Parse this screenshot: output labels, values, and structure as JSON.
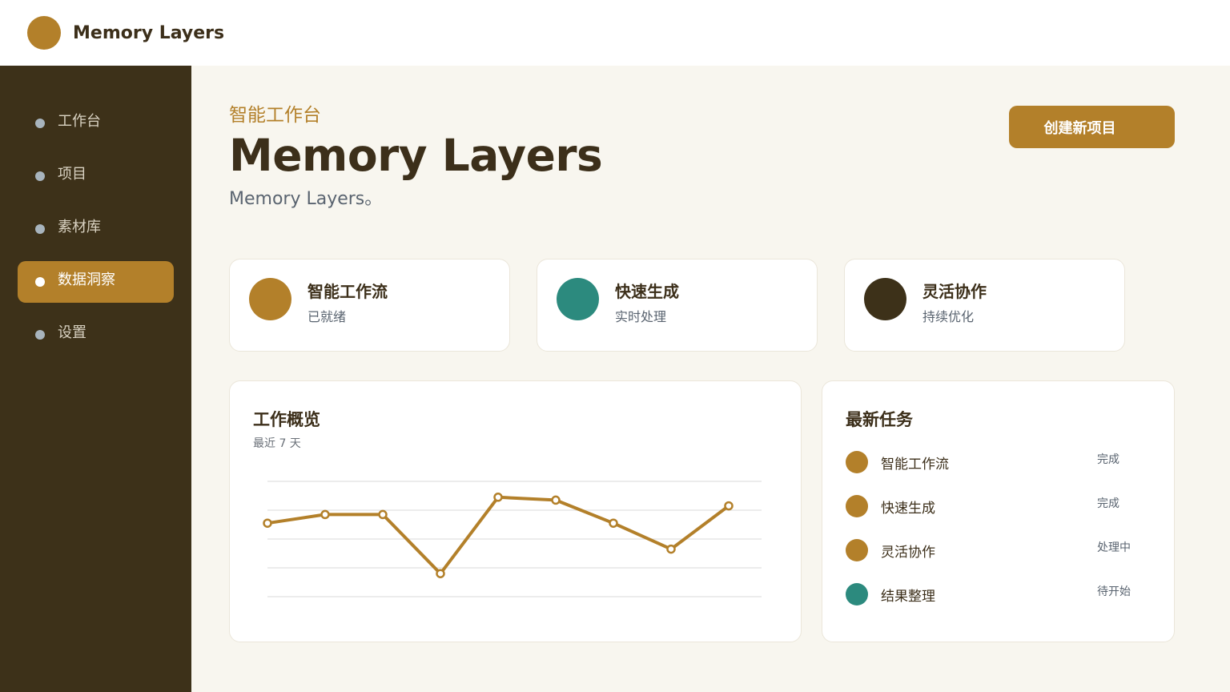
{
  "header": {
    "brand": "Memory Layers",
    "colors": {
      "logo": "#b3802a"
    }
  },
  "sidebar": {
    "items": [
      {
        "label": "工作台",
        "active": false
      },
      {
        "label": "项目",
        "active": false
      },
      {
        "label": "素材库",
        "active": false
      },
      {
        "label": "数据洞察",
        "active": true
      },
      {
        "label": "设置",
        "active": false
      }
    ]
  },
  "main": {
    "eyebrow": "智能工作台",
    "title": "Memory Layers",
    "subtitle": "Memory Layers。",
    "create_button": "创建新项目",
    "features": [
      {
        "title": "智能工作流",
        "subtitle": "已就绪",
        "color": "#b3802a"
      },
      {
        "title": "快速生成",
        "subtitle": "实时处理",
        "color": "#2c8a7e"
      },
      {
        "title": "灵活协作",
        "subtitle": "持续优化",
        "color": "#3d3119"
      }
    ],
    "overview": {
      "title": "工作概览",
      "subtitle": "最近 7 天"
    },
    "tasks": {
      "title": "最新任务",
      "items": [
        {
          "name": "智能工作流",
          "status": "完成",
          "color": "#b3802a"
        },
        {
          "name": "快速生成",
          "status": "完成",
          "color": "#b3802a"
        },
        {
          "name": "灵活协作",
          "status": "处理中",
          "color": "#b3802a"
        },
        {
          "name": "结果整理",
          "status": "待开始",
          "color": "#2c8a7e"
        }
      ]
    }
  },
  "chart_data": {
    "type": "line",
    "title": "",
    "xlabel": "",
    "ylabel": "",
    "ylim": [
      0,
      4
    ],
    "grid": true,
    "color": "#b3802a",
    "values": [
      2.55,
      2.85,
      2.85,
      0.8,
      3.45,
      3.35,
      2.55,
      1.65,
      3.15
    ]
  }
}
